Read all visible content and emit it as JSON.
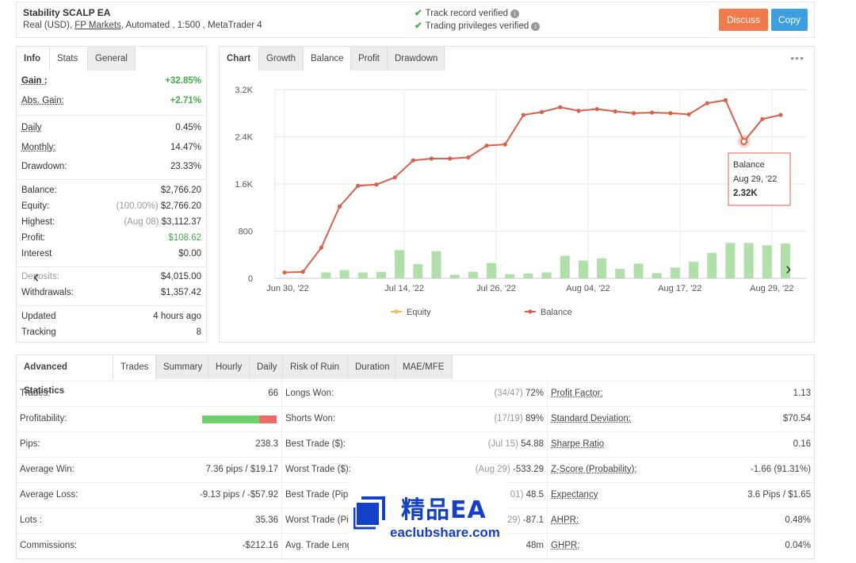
{
  "header": {
    "title": "Stability SCALP EA",
    "account_type": "Real (USD),",
    "broker": "FP Markets",
    "details": ", Automated , 1:500 , MetaTrader 4",
    "verified_track": "Track record verified",
    "verified_trading": "Trading privileges verified",
    "discuss_label": "Discuss",
    "copy_label": "Copy",
    "discuss_color": "#f07a4c",
    "copy_color": "#3d9fe0"
  },
  "info_tabs": [
    "Info",
    "Stats",
    "General"
  ],
  "info": {
    "gain_label": "Gain :",
    "gain_value": "+32.85%",
    "abs_gain_label": "Abs. Gain:",
    "abs_gain_value": "+2.71%",
    "daily_label": "Daily",
    "daily_value": "0.45%",
    "monthly_label": "Monthly:",
    "monthly_value": "14.47%",
    "drawdown_label": "Drawdown:",
    "drawdown_value": "23.33%",
    "balance_label": "Balance:",
    "balance_value": "$2,766.20",
    "equity_label": "Equity:",
    "equity_pct": "(100.00%)",
    "equity_value": "$2,766.20",
    "highest_label": "Highest:",
    "highest_date": "(Aug 08)",
    "highest_value": "$3,112.37",
    "profit_label": "Profit:",
    "profit_value": "$108.62",
    "interest_label": "Interest",
    "interest_value": "$0.00",
    "deposits_label": "Deposits:",
    "deposits_value": "$4,015.00",
    "withdrawals_label": "Withdrawals:",
    "withdrawals_value": "$1,357.42",
    "updated_label": "Updated",
    "updated_value": "4 hours ago",
    "tracking_label": "Tracking",
    "tracking_value": "8"
  },
  "chart_tabs": [
    "Chart",
    "Growth",
    "Balance",
    "Profit",
    "Drawdown"
  ],
  "chart_more": "•••",
  "chart_data": {
    "type": "line",
    "x_tick_labels": [
      "Jun 30, '22",
      "Jul 14, '22",
      "Jul 26, '22",
      "Aug 04, '22",
      "Aug 17, '22",
      "Aug 29, '22"
    ],
    "y_tick_labels": [
      "0",
      "800",
      "1.6K",
      "2.4K",
      "3.2K"
    ],
    "ylim": [
      0,
      3200
    ],
    "series": [
      {
        "name": "Balance",
        "color": "#d9614a",
        "values": [
          100,
          110,
          520,
          1220,
          1570,
          1590,
          1710,
          2000,
          2030,
          2030,
          2050,
          2250,
          2270,
          2770,
          2820,
          2900,
          2840,
          2870,
          2830,
          2800,
          2810,
          2800,
          2780,
          2970,
          3020,
          2320,
          2700,
          2770
        ]
      },
      {
        "name": "Equity",
        "color": "#f0c040",
        "values": []
      }
    ],
    "volume_bars": [
      0,
      0,
      100,
      140,
      100,
      110,
      480,
      240,
      460,
      60,
      110,
      260,
      70,
      80,
      100,
      380,
      300,
      340,
      160,
      250,
      90,
      180,
      280,
      430,
      600,
      600,
      560,
      590
    ],
    "volume_color": "#a8dca0",
    "tooltip": {
      "title": "Balance",
      "date": "Aug 29, '22",
      "value": "2.32K"
    },
    "legend": [
      "Equity",
      "Balance"
    ],
    "legend_placement": "bottom",
    "grid": true
  },
  "stats_tabs": [
    "Advanced Statistics",
    "Trades",
    "Summary",
    "Hourly",
    "Daily",
    "Risk of Ruin",
    "Duration",
    "MAE/MFE"
  ],
  "stats": {
    "col1": [
      {
        "label": "Trades:",
        "value": "66"
      },
      {
        "label": "Profitability:",
        "value": ""
      },
      {
        "label": "Pips:",
        "value": "238.3"
      },
      {
        "label": "Average Win:",
        "value": "7.36 pips / $19.17"
      },
      {
        "label": "Average Loss:",
        "value": "-9.13 pips / -$57.92"
      },
      {
        "label": "Lots :",
        "value": "35.36"
      },
      {
        "label": "Commissions:",
        "value": "-$212.16"
      }
    ],
    "profitability_fraction": 0.77,
    "col2": [
      {
        "label": "Longs Won:",
        "note": "(34/47)",
        "value": "72%"
      },
      {
        "label": "Shorts Won:",
        "note": "(17/19)",
        "value": "89%"
      },
      {
        "label": "Best Trade ($):",
        "note": "(Jul 15)",
        "value": "54.88"
      },
      {
        "label": "Worst Trade ($):",
        "note": "(Aug 29)",
        "value": "-533.29"
      },
      {
        "label": "Best Trade (Pips",
        "note": "01)",
        "value": "48.5"
      },
      {
        "label": "Worst Trade (Pip",
        "note": "29)",
        "value": "-87.1"
      },
      {
        "label": "Avg. Trade Leng",
        "note": "",
        "value": "48m"
      }
    ],
    "col3": [
      {
        "label": "Profit Factor:",
        "value": "1.13"
      },
      {
        "label": "Standard Deviation:",
        "value": "$70.54"
      },
      {
        "label": "Sharpe Ratio",
        "value": "0.16"
      },
      {
        "label": "Z-Score (Probability):",
        "value": "-1.66 (91.31%)"
      },
      {
        "label": "Expectancy",
        "value": "3.6 Pips / $1.65"
      },
      {
        "label": "AHPR:",
        "value": "0.48%"
      },
      {
        "label": "GHPR:",
        "value": "0.04%"
      }
    ]
  },
  "watermark": {
    "cn": "精品EA",
    "url": "eaclubshare.com"
  }
}
